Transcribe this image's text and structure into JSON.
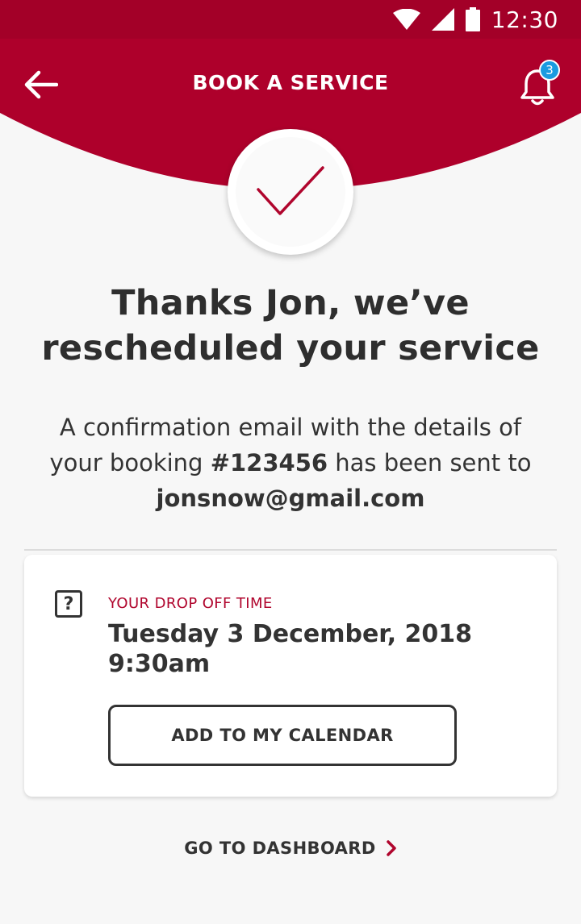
{
  "status_bar": {
    "time": "12:30",
    "icons": [
      "wifi-icon",
      "cell-signal-icon",
      "battery-icon"
    ]
  },
  "app_bar": {
    "title": "BOOK A SERVICE",
    "back_icon": "arrow-left-icon",
    "bell_icon": "bell-icon",
    "notification_count": "3"
  },
  "confirmation": {
    "icon": "checkmark-icon"
  },
  "heading": {
    "line1": "Thanks Jon, we’ve",
    "line2": "rescheduled your service"
  },
  "message": {
    "part1": "A confirmation email with the details of your booking ",
    "booking_ref": "#123456",
    "part2": " has been sent to ",
    "email": "jonsnow@gmail.com"
  },
  "drop_off": {
    "icon": "help-box-icon",
    "label": "YOUR DROP OFF TIME",
    "date": "Tuesday 3 December, 2018",
    "time": "9:30am",
    "calendar_button": "ADD TO MY CALENDAR"
  },
  "footer": {
    "dashboard_link": "GO TO DASHBOARD",
    "chevron_icon": "chevron-right-icon"
  },
  "colors": {
    "brand": "#a30028",
    "header": "#ae002b",
    "accent_text": "#b0052d",
    "badge": "#1a9be0",
    "background": "#f7f7f7"
  }
}
